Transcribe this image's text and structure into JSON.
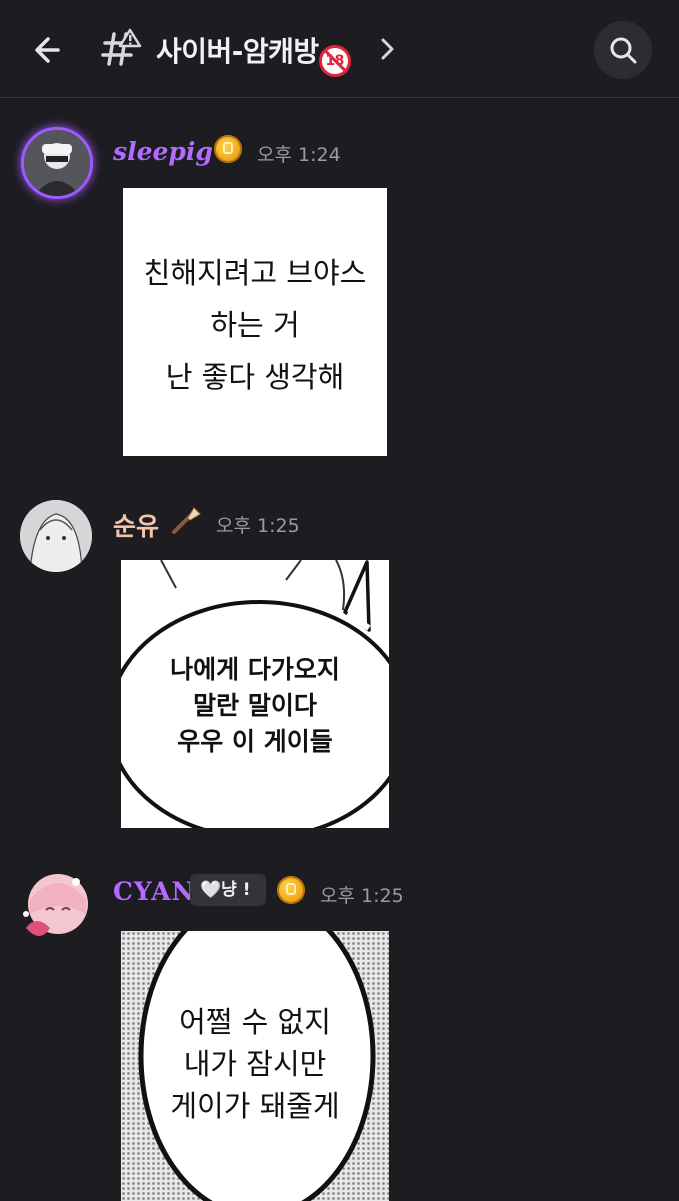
{
  "header": {
    "channel_name": "사이버-암캐방",
    "age_badge": "18",
    "back_icon": "arrow-left-icon",
    "channel_icon": "hash-warning-icon",
    "chevron_icon": "chevron-right-icon",
    "search_icon": "search-icon"
  },
  "messages": [
    {
      "username": "sleepig",
      "username_color": "#b36bff",
      "badge_icon": "gold-coin-icon",
      "time": "오후 1:24",
      "image_text": [
        "친해지려고 브야스",
        "하는 거",
        "난 좋다 생각해"
      ]
    },
    {
      "username": "순유",
      "username_color": "#f3c4a8",
      "badge_icon": "brush-icon",
      "time": "오후 1:25",
      "image_text": [
        "나에게 다가오지",
        "말란 말이다",
        "우우 이 게이들"
      ]
    },
    {
      "username": "CYAN",
      "username_color": "#b36bff",
      "role_tag": "🤍냥 !",
      "badge_icon": "gold-coin-icon",
      "time": "오후 1:25",
      "image_text": [
        "어쩔 수 없지",
        "내가 잠시만",
        "게이가 돼줄게"
      ]
    }
  ]
}
